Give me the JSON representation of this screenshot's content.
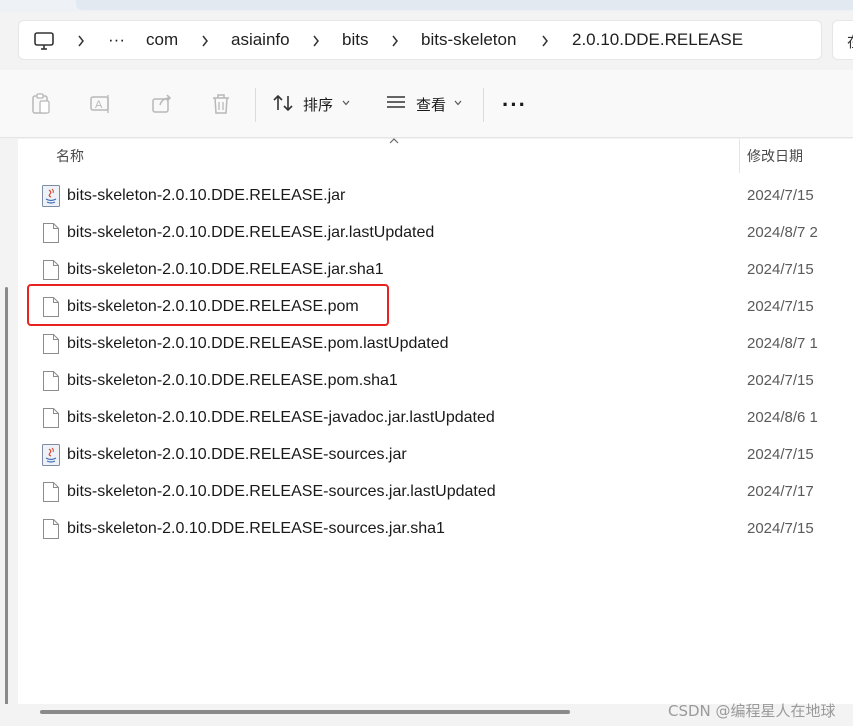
{
  "address_bar": {
    "more": "···",
    "crumbs": [
      "com",
      "asiainfo",
      "bits",
      "bits-skeleton",
      "2.0.10.DDE.RELEASE"
    ],
    "search_stub": "在"
  },
  "toolbar": {
    "sort_label": "排序",
    "view_label": "查看",
    "more": "···"
  },
  "columns": {
    "name": "名称",
    "date": "修改日期"
  },
  "files": [
    {
      "name": "bits-skeleton-2.0.10.DDE.RELEASE.jar",
      "date": "2024/7/15",
      "icon": "java-jar-icon"
    },
    {
      "name": "bits-skeleton-2.0.10.DDE.RELEASE.jar.lastUpdated",
      "date": "2024/8/7 2",
      "icon": "file-icon"
    },
    {
      "name": "bits-skeleton-2.0.10.DDE.RELEASE.jar.sha1",
      "date": "2024/7/15",
      "icon": "file-icon"
    },
    {
      "name": "bits-skeleton-2.0.10.DDE.RELEASE.pom",
      "date": "2024/7/15",
      "icon": "file-icon"
    },
    {
      "name": "bits-skeleton-2.0.10.DDE.RELEASE.pom.lastUpdated",
      "date": "2024/8/7 1",
      "icon": "file-icon"
    },
    {
      "name": "bits-skeleton-2.0.10.DDE.RELEASE.pom.sha1",
      "date": "2024/7/15",
      "icon": "file-icon"
    },
    {
      "name": "bits-skeleton-2.0.10.DDE.RELEASE-javadoc.jar.lastUpdated",
      "date": "2024/8/6 1",
      "icon": "file-icon"
    },
    {
      "name": "bits-skeleton-2.0.10.DDE.RELEASE-sources.jar",
      "date": "2024/7/15",
      "icon": "java-jar-icon"
    },
    {
      "name": "bits-skeleton-2.0.10.DDE.RELEASE-sources.jar.lastUpdated",
      "date": "2024/7/17",
      "icon": "file-icon"
    },
    {
      "name": "bits-skeleton-2.0.10.DDE.RELEASE-sources.jar.sha1",
      "date": "2024/7/15",
      "icon": "file-icon"
    }
  ],
  "watermark": "CSDN @编程星人在地球",
  "colors": {
    "highlight": "#e8221f",
    "accent": "#1a1a1a"
  }
}
